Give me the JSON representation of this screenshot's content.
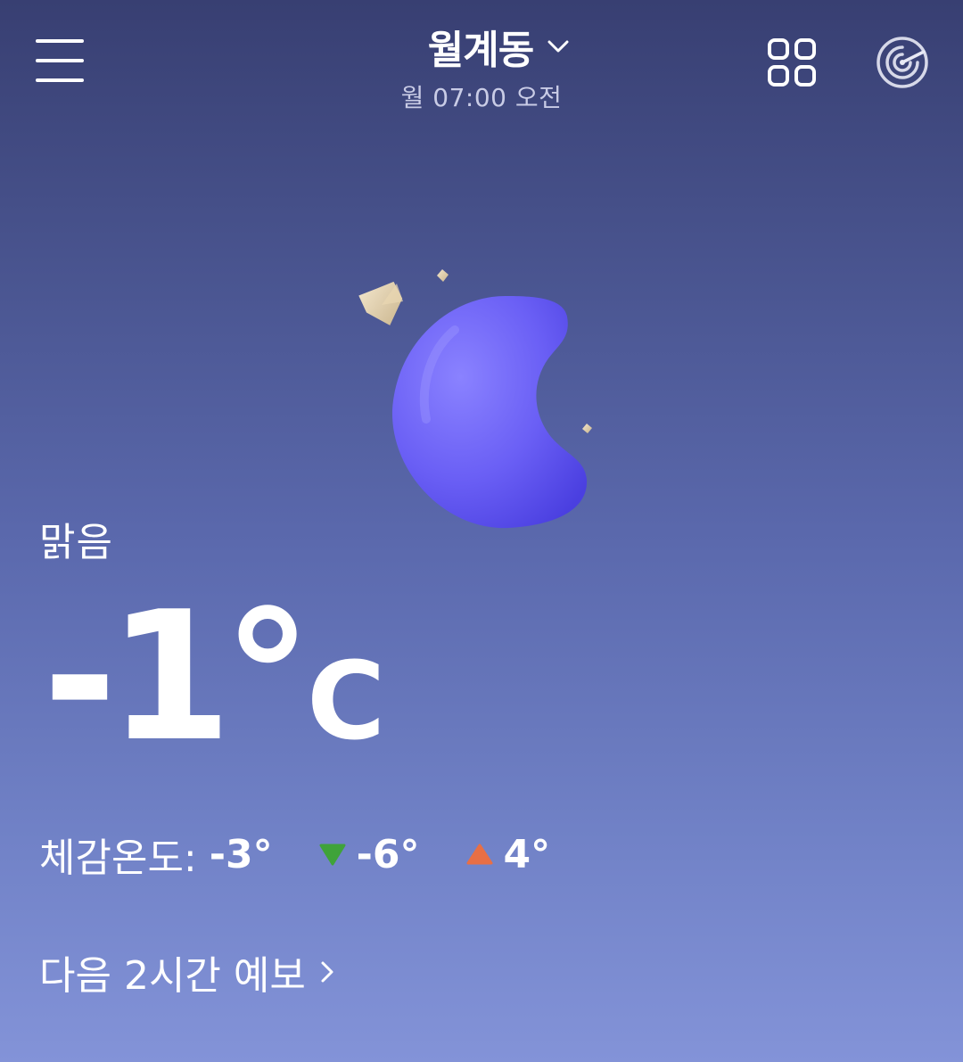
{
  "header": {
    "location": "월계동",
    "update_time": "월 07:00 오전"
  },
  "icons": {
    "menu": "hamburger-menu-icon",
    "dropdown": "chevron-down-icon",
    "grid": "grid-apps-icon",
    "radar": "radar-icon",
    "weather": "crescent-moon-stars-icon",
    "low": "triangle-down-icon",
    "high": "triangle-up-icon",
    "forecast_arrow": "chevron-right-icon"
  },
  "current": {
    "condition": "맑음",
    "temperature": "-1°",
    "unit": "C",
    "feels_like_label": "체감온도:",
    "feels_like": "-3°",
    "low": "-6°",
    "high": "4°"
  },
  "forecast_link": {
    "label": "다음 2시간 예보"
  },
  "colors": {
    "low_arrow": "#3fa33a",
    "high_arrow": "#e86f45",
    "moon": "#6a5ff5",
    "background_top": "#383f72",
    "background_bottom": "#8393d8"
  }
}
